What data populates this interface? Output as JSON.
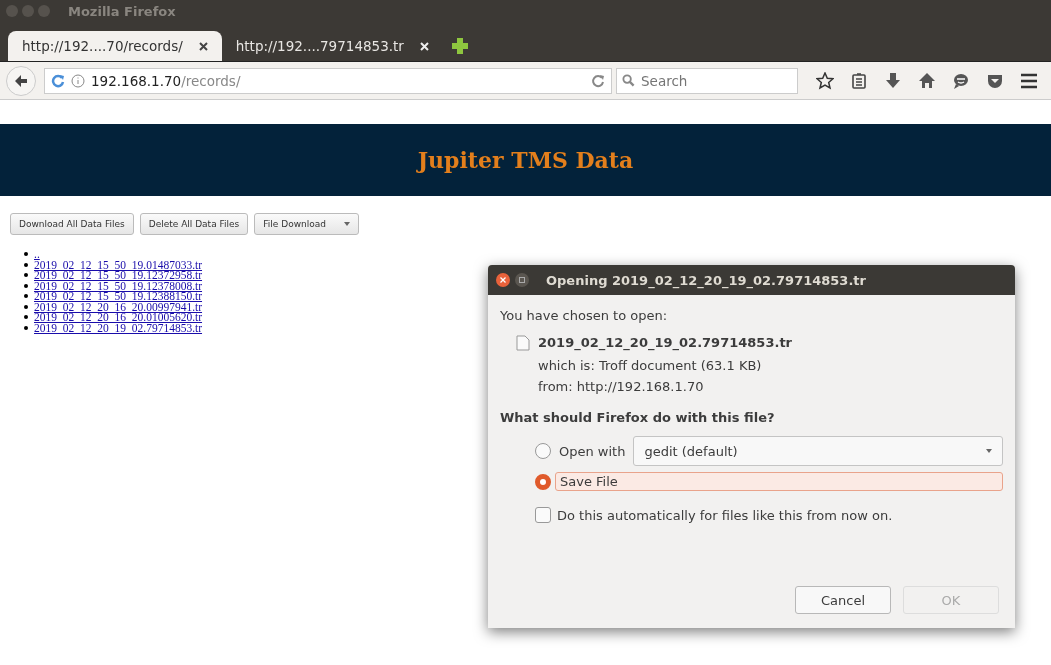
{
  "window": {
    "title": "Mozilla Firefox"
  },
  "tabs": [
    {
      "label": "http://192....70/records/",
      "selected": true
    },
    {
      "label": "http://192....79714853.tr",
      "selected": false
    }
  ],
  "address_bar": {
    "host": "192.168.1.70",
    "path": "/records/"
  },
  "search": {
    "placeholder": "Search"
  },
  "page": {
    "heading": "Jupiter TMS Data",
    "buttons": [
      {
        "label": "Download All Data Files",
        "kind": "plain"
      },
      {
        "label": "Delete All Data Files",
        "kind": "plain"
      },
      {
        "label": "File Download",
        "kind": "split"
      }
    ],
    "links": [
      "..",
      "2019_02_12_15_50_19.01487033.tr",
      "2019_02_12_15_50_19.12372958.tr",
      "2019_02_12_15_50_19.12378008.tr",
      "2019_02_12_15_50_19.12388150.tr",
      "2019_02_12_20_16_20.00997941.tr",
      "2019_02_12_20_16_20.01005620.tr",
      "2019_02_12_20_19_02.79714853.tr"
    ]
  },
  "dialog": {
    "title": "Opening 2019_02_12_20_19_02.79714853.tr",
    "intro": "You have chosen to open:",
    "file_name": "2019_02_12_20_19_02.79714853.tr",
    "which_is": "which is: Troff document (63.1 KB)",
    "from": "from: http://192.168.1.70",
    "question": "What should Firefox do with this file?",
    "options": [
      {
        "label": "Open with",
        "selected": false,
        "app": "gedit (default)"
      },
      {
        "label": "Save File",
        "selected": true
      }
    ],
    "auto": {
      "label": "Do this automatically for files like this from now on.",
      "checked": false
    },
    "buttons": [
      {
        "label": "Cancel",
        "disabled": false
      },
      {
        "label": "OK",
        "disabled": true
      }
    ]
  }
}
